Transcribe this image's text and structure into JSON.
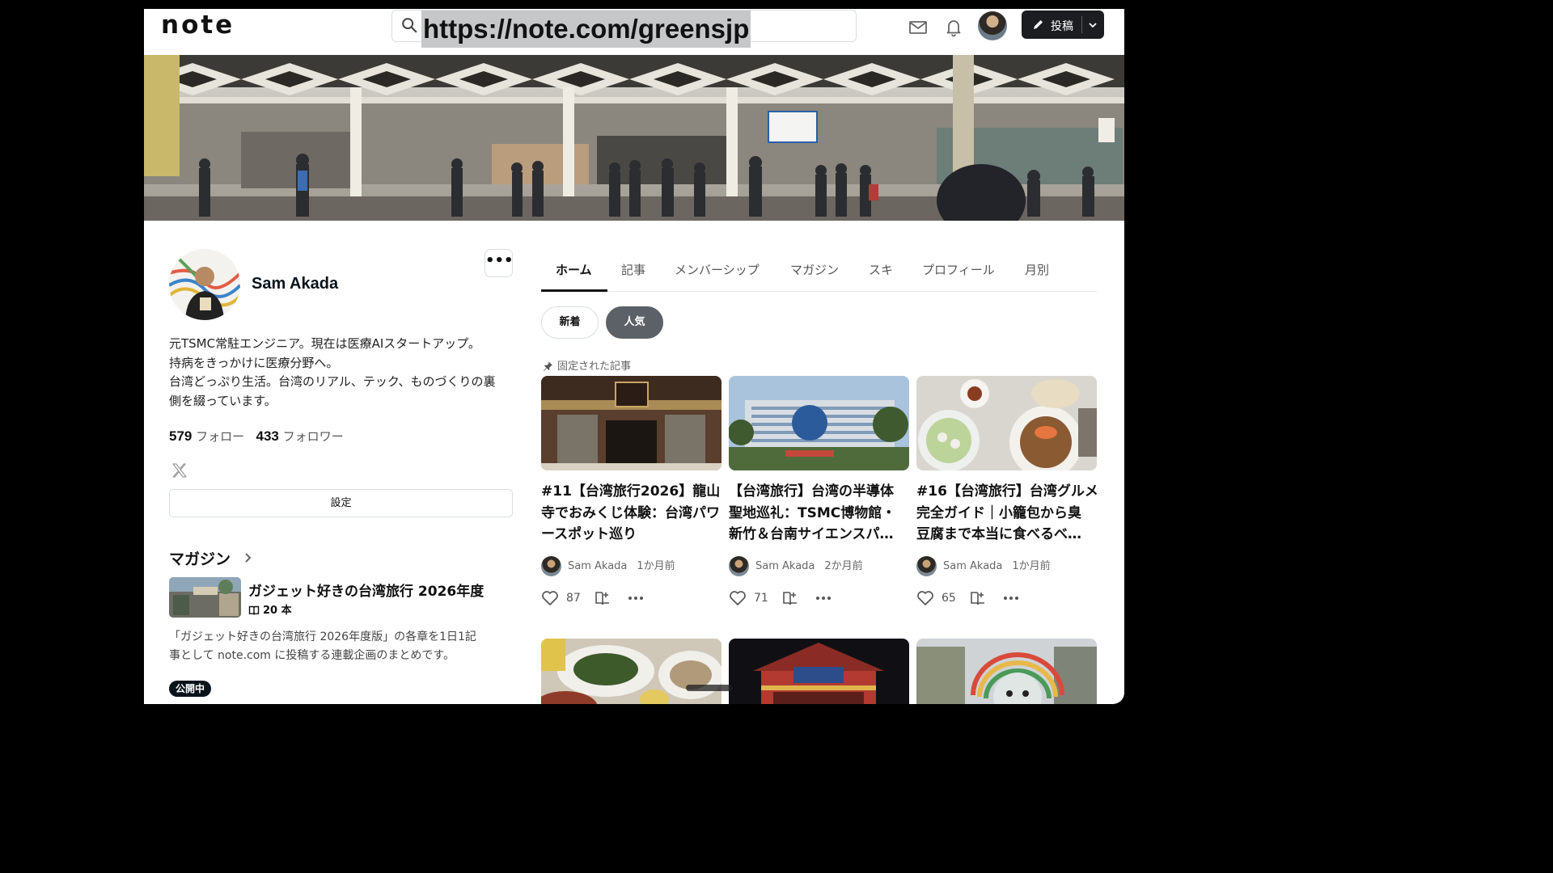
{
  "header": {
    "logo": "note",
    "url": "https://note.com/greensjp",
    "post_label": "投稿"
  },
  "profile": {
    "name": "Sam Akada",
    "more_label": "•••",
    "bio": [
      "元TSMC常駐エンジニア。現在は医療AIスタートアップ。",
      "持病をきっかけに医療分野へ。",
      "台湾どっぷり生活。台湾のリアル、テック、ものづくりの裏",
      "側を綴っています。"
    ],
    "follow_count": "579",
    "follow_label": "フォロー",
    "follower_count": "433",
    "follower_label": "フォロワー",
    "settings_label": "設定"
  },
  "magazine": {
    "heading": "マガジン",
    "title": "ガジェット好きの台湾旅行 2026年度",
    "count": "20 本",
    "description": [
      "「ガジェット好きの台湾旅行 2026年度版」の各章を1日1記",
      "事として note.com に投稿する連載企画のまとめです。"
    ],
    "status": "公開中"
  },
  "tabs": [
    "ホーム",
    "記事",
    "メンバーシップ",
    "マガジン",
    "スキ",
    "プロフィール",
    "月別"
  ],
  "filters": {
    "new": "新着",
    "popular": "人気"
  },
  "pinned_label": "固定された記事",
  "articles": [
    {
      "title_lines": [
        "#11【台湾旅行2026】龍山",
        "寺でおみくじ体験：台湾パワ",
        "ースポット巡り"
      ],
      "author": "Sam Akada",
      "time": "1か月前",
      "likes": "87"
    },
    {
      "title_lines": [
        "【台湾旅行】台湾の半導体",
        "聖地巡礼：TSMC博物館・",
        "新竹＆台南サイエンスパ…"
      ],
      "author": "Sam Akada",
      "time": "2か月前",
      "likes": "71"
    },
    {
      "title_lines": [
        "#16【台湾旅行】台湾グルメ",
        "完全ガイド｜小籠包から臭",
        "豆腐まで本当に食べるべ…"
      ],
      "author": "Sam Akada",
      "time": "1か月前",
      "likes": "65"
    }
  ],
  "colors": {
    "page_bg": "#ffffff",
    "frame": "#000000",
    "dark_button": "#1b1d20",
    "chip_active": "#5b6166",
    "text": "#08131a"
  }
}
